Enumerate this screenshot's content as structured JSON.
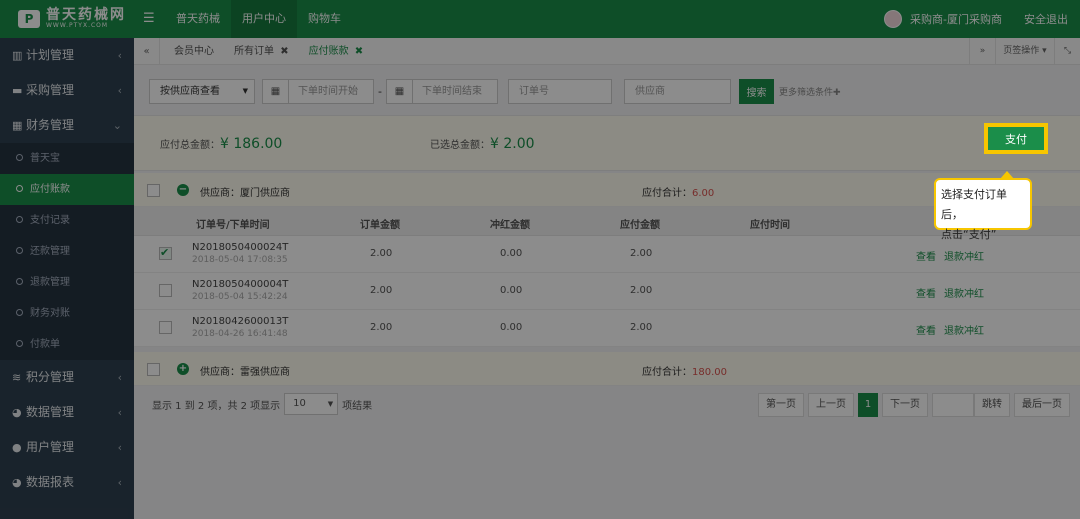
{
  "brand": {
    "name": "普天药械网",
    "sub": "WWW.PTYX.COM",
    "mark": "P"
  },
  "topnav": {
    "menu_icon": "☰",
    "items": [
      "普天药械",
      "用户中心",
      "购物车"
    ],
    "active_index": 1
  },
  "user": {
    "name": "采购商-厦门采购商",
    "logout": "安全退出"
  },
  "sidebar": {
    "groups": [
      {
        "label": "计划管理",
        "icon": "bar-chart-icon"
      },
      {
        "label": "采购管理",
        "icon": "briefcase-icon"
      },
      {
        "label": "财务管理",
        "icon": "calculator-icon",
        "expanded": true,
        "children": [
          "普天宝",
          "应付账款",
          "支付记录",
          "还款管理",
          "退款管理",
          "财务对账",
          "付款单"
        ],
        "active_child": 1
      },
      {
        "label": "积分管理",
        "icon": "database-icon"
      },
      {
        "label": "数据管理",
        "icon": "pie-chart-icon"
      },
      {
        "label": "用户管理",
        "icon": "user-icon"
      },
      {
        "label": "数据报表",
        "icon": "pie-chart-icon"
      }
    ]
  },
  "tabs": {
    "back_icon": "«",
    "forward_icon": "»",
    "items": [
      {
        "label": "会员中心",
        "closable": false
      },
      {
        "label": "所有订单",
        "closable": true
      },
      {
        "label": "应付账款",
        "closable": true,
        "active": true
      }
    ],
    "close_mark": "✖",
    "page_ops": "页签操作",
    "fullscreen_icon": "⤡"
  },
  "filter": {
    "mode": "按供应商查看",
    "date_start": "下单时间开始",
    "date_sep": "-",
    "date_end": "下单时间结束",
    "order_no": "订单号",
    "supplier": "供应商",
    "search": "搜索",
    "more": "更多筛选条件"
  },
  "summary": {
    "payable_label": "应付总金额：",
    "payable_value": "¥ 186.00",
    "selected_label": "已选总金额：",
    "selected_value": "¥ 2.00",
    "pay_button": "支付"
  },
  "suppliers": [
    {
      "name": "供应商：厦门供应商",
      "total_label": "应付合计：",
      "total": "6.00",
      "collapsed": false
    },
    {
      "name": "供应商：雷强供应商",
      "total_label": "应付合计：",
      "total": "180.00",
      "collapsed": true
    }
  ],
  "table": {
    "columns": [
      "订单号/下单时间",
      "订单金额",
      "冲红金额",
      "应付金额",
      "应付时间"
    ],
    "rows": [
      {
        "order_no": "N2018050400024T",
        "time": "2018-05-04 17:08:35",
        "amount": "2.00",
        "offset": "0.00",
        "payable": "2.00",
        "checked": true
      },
      {
        "order_no": "N2018050400004T",
        "time": "2018-05-04 15:42:24",
        "amount": "2.00",
        "offset": "0.00",
        "payable": "2.00",
        "checked": false
      },
      {
        "order_no": "N2018042600013T",
        "time": "2018-04-26 16:41:48",
        "amount": "2.00",
        "offset": "0.00",
        "payable": "2.00",
        "checked": false
      }
    ],
    "actions": [
      "查看",
      "退款冲红"
    ]
  },
  "pagination": {
    "info_prefix": "显示 1 到 2 项，共 2 项显示",
    "page_size": "10",
    "info_suffix": "项结果",
    "first": "第一页",
    "prev": "上一页",
    "current": "1",
    "next": "下一页",
    "jump": "跳转",
    "last": "最后一页"
  },
  "tooltip": {
    "line1": "选择支付订单后，",
    "line2": "点击“支付”"
  },
  "colors": {
    "brand": "#1b8e4a",
    "highlight": "#f7c600",
    "sidebar": "#2f4050",
    "total_red": "#d9534f"
  }
}
